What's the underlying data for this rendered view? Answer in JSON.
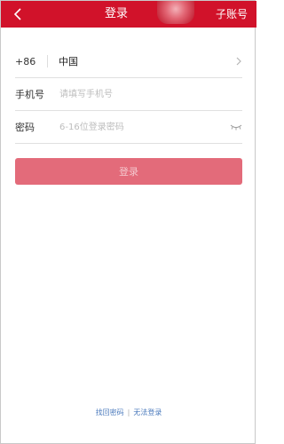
{
  "header": {
    "title": "登录",
    "sub_account_label": "子账号",
    "back_icon": "chevron-left-icon"
  },
  "form": {
    "country_code": "+86",
    "country_name": "中国",
    "phone_label": "手机号",
    "phone_placeholder": "请填写手机号",
    "password_label": "密码",
    "password_placeholder": "6-16位登录密码"
  },
  "actions": {
    "login_label": "登录"
  },
  "footer": {
    "find_password": "找回密码",
    "separator": "|",
    "cannot_login": "无法登录"
  },
  "colors": {
    "brand": "#d1122a",
    "login_button": "#e36b7a",
    "link": "#4c7bbd"
  }
}
